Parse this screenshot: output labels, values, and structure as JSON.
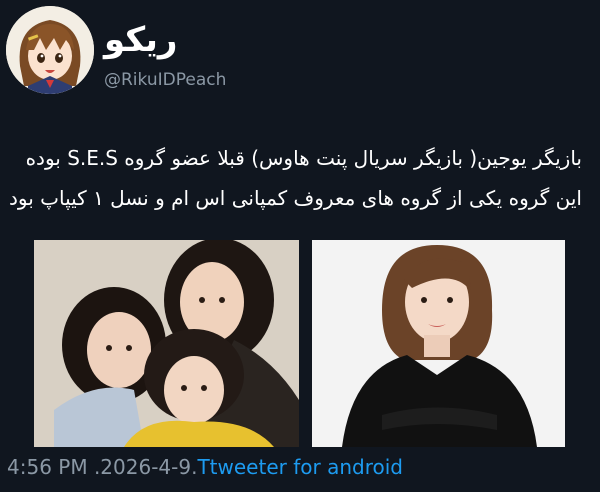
{
  "tweet": {
    "display_name": "ریکو",
    "handle": "@RikuIDPeach",
    "text_lines": [
      "بازیگر یوجین( بازیگر سریال پنت هاوس) قبلا عضو گروه S.E.S بوده",
      "این گروه یکی از گروه های معروف کمپانی اس ام و نسل ۱ کیپاپ بود"
    ],
    "time": "4:56 PM",
    "date": ".2026-4-9.",
    "source": "Ttweeter for android"
  },
  "colors": {
    "background": "#10161f",
    "text": "#ffffff",
    "muted": "#8b98a5",
    "link": "#1d9bf0"
  },
  "icons": {
    "avatar": "anime-girl-avatar"
  }
}
